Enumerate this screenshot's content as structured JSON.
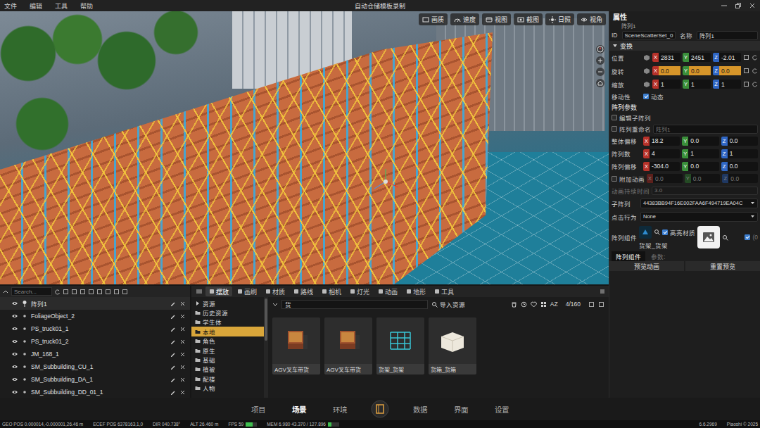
{
  "menubar": {
    "items": [
      "文件",
      "编辑",
      "工具",
      "帮助"
    ],
    "title": "自动仓储模板录制"
  },
  "viewport": {
    "toolbar": [
      "画质",
      "速度",
      "视图",
      "截图",
      "日照",
      "视角"
    ]
  },
  "properties": {
    "header": "属性",
    "subtitle": "阵列1",
    "id_label": "ID",
    "id_value": "SceneScatterSet_0",
    "name_label": "名称",
    "name_value": "阵列1",
    "transform_title": "变换",
    "axes": [
      "X",
      "Y",
      "Z"
    ],
    "transform": [
      {
        "label": "位置",
        "highlighted": false,
        "x": "2831",
        "y": "2451",
        "z": "-2.01"
      },
      {
        "label": "旋转",
        "highlighted": true,
        "x": "0.0",
        "y": "0.0",
        "z": "0.0"
      },
      {
        "label": "缩放",
        "highlighted": false,
        "x": "1",
        "y": "1",
        "z": "1"
      }
    ],
    "mobility": {
      "label": "移动性",
      "checked": true,
      "text": "动态"
    },
    "array_title": "阵列参数",
    "edit_child": {
      "label": "编辑子阵列",
      "checked": false
    },
    "rename": {
      "label": "阵列重命名",
      "checked": false,
      "value": "阵列1"
    },
    "vectors": [
      {
        "label": "整体偏移",
        "x": "18.2",
        "y": "0.0",
        "z": "0.0"
      },
      {
        "label": "阵列数",
        "x": "4",
        "y": "1",
        "z": "1"
      },
      {
        "label": "阵列偏移",
        "x": "-304.0",
        "y": "0.0",
        "z": "0.0"
      }
    ],
    "anim": {
      "label": "附加动画",
      "checked": false,
      "x": "0.0",
      "y": "0.0",
      "z": "0.0"
    },
    "duration": {
      "label": "动画持续时间",
      "value": "3.0",
      "disabled": true
    },
    "child_array": {
      "label": "子阵列",
      "value": "44383BB94F16E002FAA6F494719EA04C"
    },
    "click": {
      "label": "点击行为",
      "value": "None"
    },
    "component": {
      "label": "阵列组件",
      "highlight_label": "高亮材质",
      "highlight_checked": true,
      "asset": "货架_货架",
      "side_checked": true,
      "side_text": "(0"
    },
    "tabs": [
      {
        "label": "阵列组件",
        "selected": true
      }
    ],
    "param_label": "参数:",
    "buttons": [
      "预览动画",
      "重置预览"
    ]
  },
  "outliner": {
    "search_placeholder": "Search...",
    "items": [
      {
        "label": "阵列1",
        "kind": "array",
        "visible": true,
        "selected": true
      },
      {
        "label": "FoliageObject_2",
        "kind": "object",
        "visible": true,
        "selected": false
      },
      {
        "label": "PS_truck01_1",
        "kind": "object",
        "visible": true,
        "selected": false
      },
      {
        "label": "PS_truck01_2",
        "kind": "object",
        "visible": true,
        "selected": false
      },
      {
        "label": "JM_168_1",
        "kind": "object",
        "visible": true,
        "selected": false
      },
      {
        "label": "SM_Subbuilding_CU_1",
        "kind": "object",
        "visible": true,
        "selected": false
      },
      {
        "label": "SM_Subbuilding_DA_1",
        "kind": "object",
        "visible": true,
        "selected": false
      },
      {
        "label": "SM_Subbuilding_DD_01_1",
        "kind": "object",
        "visible": true,
        "selected": false
      }
    ]
  },
  "assets": {
    "tabs": [
      {
        "label": "摆放",
        "selected": true
      },
      {
        "label": "画刷",
        "selected": false
      },
      {
        "label": "材质",
        "selected": false
      },
      {
        "label": "路线",
        "selected": false
      },
      {
        "label": "相机",
        "selected": false
      },
      {
        "label": "灯光",
        "selected": false
      },
      {
        "label": "动画",
        "selected": false
      },
      {
        "label": "地形",
        "selected": false
      },
      {
        "label": "工具",
        "selected": false
      }
    ],
    "tree": [
      {
        "label": "资源",
        "kind": "root",
        "selected": false
      },
      {
        "label": "历史资源",
        "kind": "folder",
        "selected": false
      },
      {
        "label": "学生体",
        "kind": "folder",
        "selected": false
      },
      {
        "label": "本地",
        "kind": "folder",
        "selected": true
      },
      {
        "label": "角色",
        "kind": "folder",
        "selected": false
      },
      {
        "label": "原生",
        "kind": "folder",
        "selected": false
      },
      {
        "label": "基础",
        "kind": "folder",
        "selected": false
      },
      {
        "label": "植被",
        "kind": "folder",
        "selected": false
      },
      {
        "label": "配楼",
        "kind": "folder",
        "selected": false
      },
      {
        "label": "人物",
        "kind": "folder",
        "selected": false
      }
    ],
    "search_value": "货",
    "import_label": "导入资源",
    "sort_label": "AZ",
    "count": "4/160",
    "cards": [
      {
        "label": "AGV叉车带货",
        "kind": "forklift"
      },
      {
        "label": "AGV叉车带货",
        "kind": "forklift"
      },
      {
        "label": "货架_货架",
        "kind": "rack"
      },
      {
        "label": "货箱_货箱",
        "kind": "crate"
      }
    ]
  },
  "nav": {
    "left": [
      {
        "label": "项目",
        "selected": false
      },
      {
        "label": "场景",
        "selected": true
      },
      {
        "label": "环境",
        "selected": false
      }
    ],
    "right": [
      {
        "label": "数据",
        "selected": false
      },
      {
        "label": "界面",
        "selected": false
      },
      {
        "label": "设置",
        "selected": false
      }
    ]
  },
  "status": {
    "left": [
      {
        "text": "GEO POS 0.000014,-0.000001,26.46 m",
        "kind": "text"
      },
      {
        "text": "ECEF POS 6378163,1,0",
        "kind": "text"
      },
      {
        "text": "DIR 040.738°",
        "kind": "text"
      },
      {
        "text": "ALT 26.460 m",
        "kind": "text"
      },
      {
        "text": "FPS 59",
        "kind": "meter",
        "level": 0.6
      },
      {
        "text": "MEM 6.980 43.370 / 127.896",
        "kind": "meter",
        "level": 0.34
      }
    ],
    "right": [
      "6.6.2969",
      "Piaoshi © 2025"
    ]
  }
}
